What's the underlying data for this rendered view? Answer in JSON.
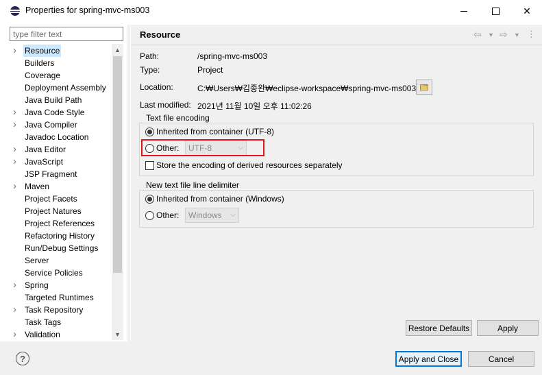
{
  "window": {
    "title": "Properties for spring-mvc-ms003"
  },
  "filter": {
    "placeholder": "type filter text"
  },
  "tree": {
    "items": [
      {
        "label": "Resource",
        "expandable": true,
        "selected": true
      },
      {
        "label": "Builders",
        "expandable": false
      },
      {
        "label": "Coverage",
        "expandable": false
      },
      {
        "label": "Deployment Assembly",
        "expandable": false
      },
      {
        "label": "Java Build Path",
        "expandable": false
      },
      {
        "label": "Java Code Style",
        "expandable": true
      },
      {
        "label": "Java Compiler",
        "expandable": true
      },
      {
        "label": "Javadoc Location",
        "expandable": false
      },
      {
        "label": "Java Editor",
        "expandable": true
      },
      {
        "label": "JavaScript",
        "expandable": true
      },
      {
        "label": "JSP Fragment",
        "expandable": false
      },
      {
        "label": "Maven",
        "expandable": true
      },
      {
        "label": "Project Facets",
        "expandable": false
      },
      {
        "label": "Project Natures",
        "expandable": false
      },
      {
        "label": "Project References",
        "expandable": false
      },
      {
        "label": "Refactoring History",
        "expandable": false
      },
      {
        "label": "Run/Debug Settings",
        "expandable": false
      },
      {
        "label": "Server",
        "expandable": false
      },
      {
        "label": "Service Policies",
        "expandable": false
      },
      {
        "label": "Spring",
        "expandable": true
      },
      {
        "label": "Targeted Runtimes",
        "expandable": false
      },
      {
        "label": "Task Repository",
        "expandable": true
      },
      {
        "label": "Task Tags",
        "expandable": false
      },
      {
        "label": "Validation",
        "expandable": true
      }
    ]
  },
  "page": {
    "title": "Resource",
    "path_label": "Path:",
    "path_value": "/spring-mvc-ms003",
    "type_label": "Type:",
    "type_value": "Project",
    "location_label": "Location:",
    "location_value": "C:₩Users₩김종완₩eclipse-workspace₩spring-mvc-ms003",
    "modified_label": "Last modified:",
    "modified_value": "2021년 11월 10일 오후 11:02:26"
  },
  "encoding": {
    "group_title": "Text file encoding",
    "inherited_label": "Inherited from container (UTF-8)",
    "other_label": "Other:",
    "other_value": "UTF-8",
    "store_label": "Store the encoding of derived resources separately"
  },
  "delimiter": {
    "group_title": "New text file line delimiter",
    "inherited_label": "Inherited from container (Windows)",
    "other_label": "Other:",
    "other_value": "Windows"
  },
  "buttons": {
    "restore_defaults": "Restore Defaults",
    "apply": "Apply",
    "apply_and_close": "Apply and Close",
    "cancel": "Cancel"
  },
  "colors": {
    "selection": "#cce8ff",
    "highlight": "#e0141b",
    "default_button_border": "#0078d7"
  }
}
